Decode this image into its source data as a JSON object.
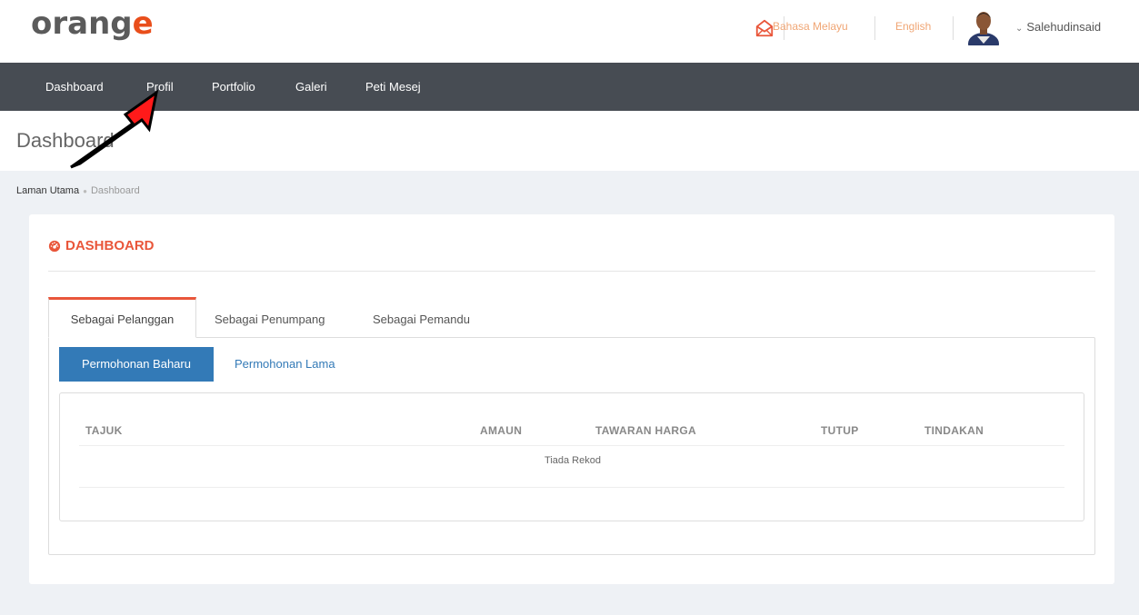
{
  "brand": {
    "logo_main": "orang",
    "logo_accent": "e"
  },
  "header": {
    "lang_ms": "Bahasa Melayu",
    "lang_en": "English",
    "username": "Salehudinsaid"
  },
  "nav": {
    "items": [
      "Dashboard",
      "Profil",
      "Portfolio",
      "Galeri",
      "Peti Mesej"
    ]
  },
  "page": {
    "title": "Dashboard"
  },
  "breadcrumb": {
    "home": "Laman Utama",
    "current": "Dashboard"
  },
  "panel": {
    "heading": "DASHBOARD",
    "tabs": [
      "Sebagai Pelanggan",
      "Sebagai Penumpang",
      "Sebagai Pemandu"
    ],
    "pills": [
      "Permohonan Baharu",
      "Permohonan Lama"
    ],
    "table": {
      "columns": [
        "TAJUK",
        "AMAUN",
        "TAWARAN HARGA",
        "TUTUP",
        "TINDAKAN"
      ],
      "empty_text": "Tiada Rekod"
    }
  },
  "colors": {
    "accent": "#e9563a",
    "nav_bg": "#474c53",
    "primary": "#337ab7",
    "content_bg": "#eef1f5"
  },
  "icons": {
    "mail": "envelope-open-icon",
    "dashboard": "dashboard-gauge-icon",
    "annotation": "red-arrow-icon"
  }
}
